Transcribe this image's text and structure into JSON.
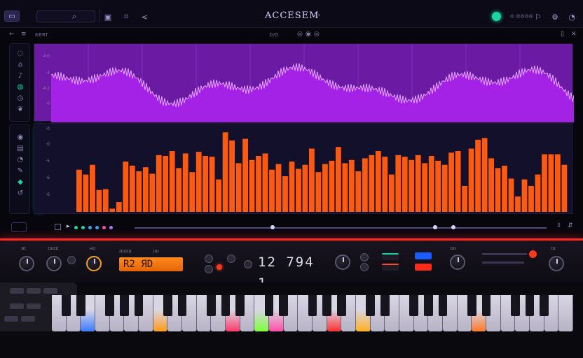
{
  "app": {
    "title": "ACCESEM",
    "title_suffix": "⁝ ›"
  },
  "topbar": {
    "status_text": "◎ ◎◎◎◎"
  },
  "subbar": {
    "left_label": "E⁄ERT",
    "center_label": "ΣΙ⁄O"
  },
  "waveform": {
    "color": "#9b1fd6",
    "scale_labels": [
      "4·0",
      "·4",
      "4·2",
      "·0",
      "·0"
    ]
  },
  "bars": {
    "color": "#ff5a10",
    "scale_labels": [
      "·0",
      "·0",
      "·5",
      "·6",
      "·6",
      "·0"
    ],
    "values": [
      0.52,
      0.46,
      0.58,
      0.27,
      0.28,
      0.04,
      0.12,
      0.62,
      0.57,
      0.5,
      0.55,
      0.47,
      0.7,
      0.69,
      0.75,
      0.54,
      0.72,
      0.49,
      0.74,
      0.69,
      0.68,
      0.4,
      0.98,
      0.88,
      0.6,
      0.9,
      0.64,
      0.69,
      0.72,
      0.52,
      0.59,
      0.44,
      0.62,
      0.53,
      0.58,
      0.78,
      0.49,
      0.59,
      0.63,
      0.8,
      0.6,
      0.64,
      0.5,
      0.66,
      0.7,
      0.75,
      0.68,
      0.46,
      0.7,
      0.68,
      0.64,
      0.7,
      0.6,
      0.69,
      0.63,
      0.58,
      0.73,
      0.75,
      0.32,
      0.78,
      0.89,
      0.91,
      0.66,
      0.54,
      0.57,
      0.41,
      0.19,
      0.4,
      0.32,
      0.46,
      0.71,
      0.71,
      0.71,
      0.58
    ],
    "glow_color": "#ff3a00"
  },
  "hardware": {
    "display_text": "R2 ЯD",
    "lcd_text": "12 794 1",
    "labels": [
      "ɪɪɪ",
      "ɪɪɪɪɪɪɪ",
      "ʜɪɪ",
      "ɪɪɪɪɪɪɪɪ",
      "ɪɪɪɪ",
      "ɪɪɪɪ",
      "ɪɪɪ"
    ]
  },
  "keyboard": {
    "white_keys": 36,
    "highlights": [
      {
        "key": 2,
        "color": "#3a7bff"
      },
      {
        "key": 7,
        "color": "#ff9a1a"
      },
      {
        "key": 12,
        "color": "#ff3b6a"
      },
      {
        "key": 14,
        "color": "#7cff3a"
      },
      {
        "key": 15,
        "color": "#ff4fa6"
      },
      {
        "key": 19,
        "color": "#ff3030"
      },
      {
        "key": 21,
        "color": "#ffb020"
      },
      {
        "key": 29,
        "color": "#ff7a2a"
      }
    ]
  }
}
